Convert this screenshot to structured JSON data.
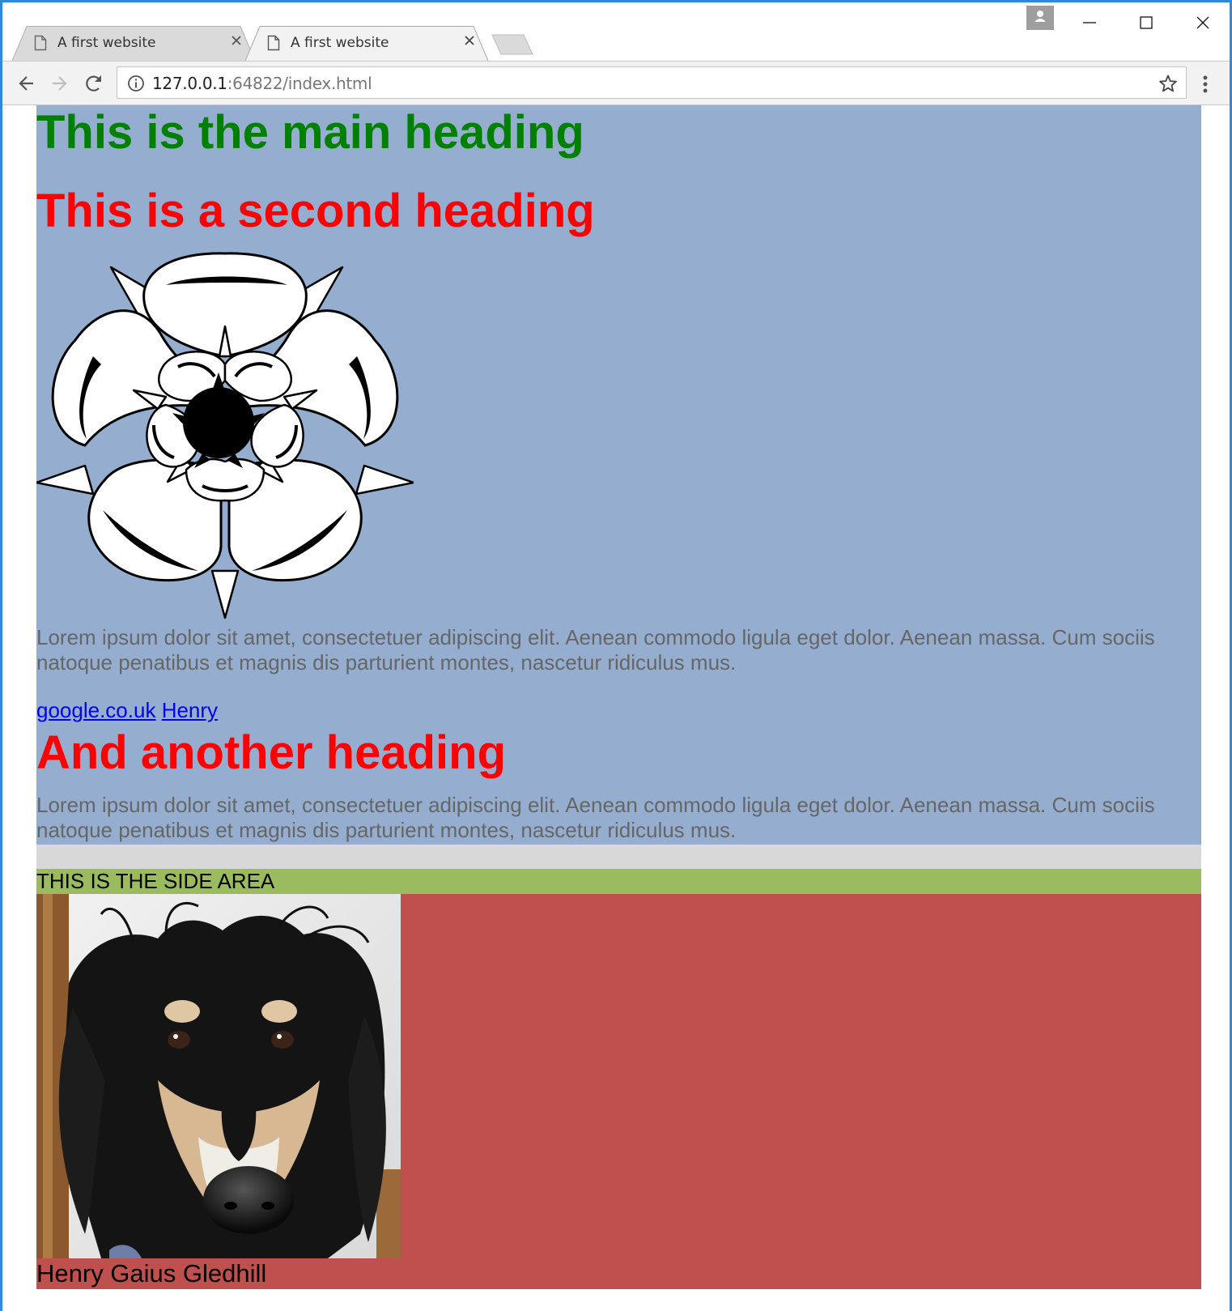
{
  "browser": {
    "tabs": [
      {
        "title": "A first website",
        "active": false
      },
      {
        "title": "A first website",
        "active": true
      }
    ],
    "address_bar": {
      "host": "127.0.0.1",
      "rest": ":64822/index.html"
    },
    "icons": {
      "tab_doc": "document-icon",
      "tab_close": "close-icon",
      "back": "arrow-left-icon",
      "forward": "arrow-right-icon",
      "reload": "reload-icon",
      "info": "info-icon",
      "bookmark": "star-icon",
      "menu": "kebab-menu-icon",
      "profile": "person-icon",
      "minimize": "minimize-icon",
      "maximize": "maximize-icon",
      "close_window": "close-icon"
    },
    "colors": {
      "window_border": "#2b8ae0",
      "active_tab": "#f2f2f2",
      "inactive_tab": "#dadada"
    }
  },
  "page": {
    "main_heading": "This is the main heading",
    "second_heading": "This is a second heading",
    "paragraph_1": "Lorem ipsum dolor sit amet, consectetuer adipiscing elit. Aenean commodo ligula eget dolor. Aenean massa. Cum sociis natoque penatibus et magnis dis parturient montes, nascetur ridiculus mus.",
    "links": [
      {
        "label": "google.co.uk"
      },
      {
        "label": "Henry"
      }
    ],
    "third_heading": "And another heading",
    "paragraph_2": "Lorem ipsum dolor sit amet, consectetuer adipiscing elit. Aenean commodo ligula eget dolor. Aenean massa. Cum sociis natoque penatibus et magnis dis parturient montes, nascetur ridiculus mus.",
    "side_area_label": "THIS IS THE SIDE AREA",
    "dog_caption": "Henry Gaius Gledhill",
    "colors": {
      "main_bg": "#95aecf",
      "main_heading": "#008000",
      "headings": "#ff0000",
      "paragraph_text": "#666666",
      "link": "#0000ee",
      "gray_strip": "#d8d8d8",
      "side_area_bg": "#9bbb5f",
      "profile_bg": "#c0504d"
    }
  }
}
